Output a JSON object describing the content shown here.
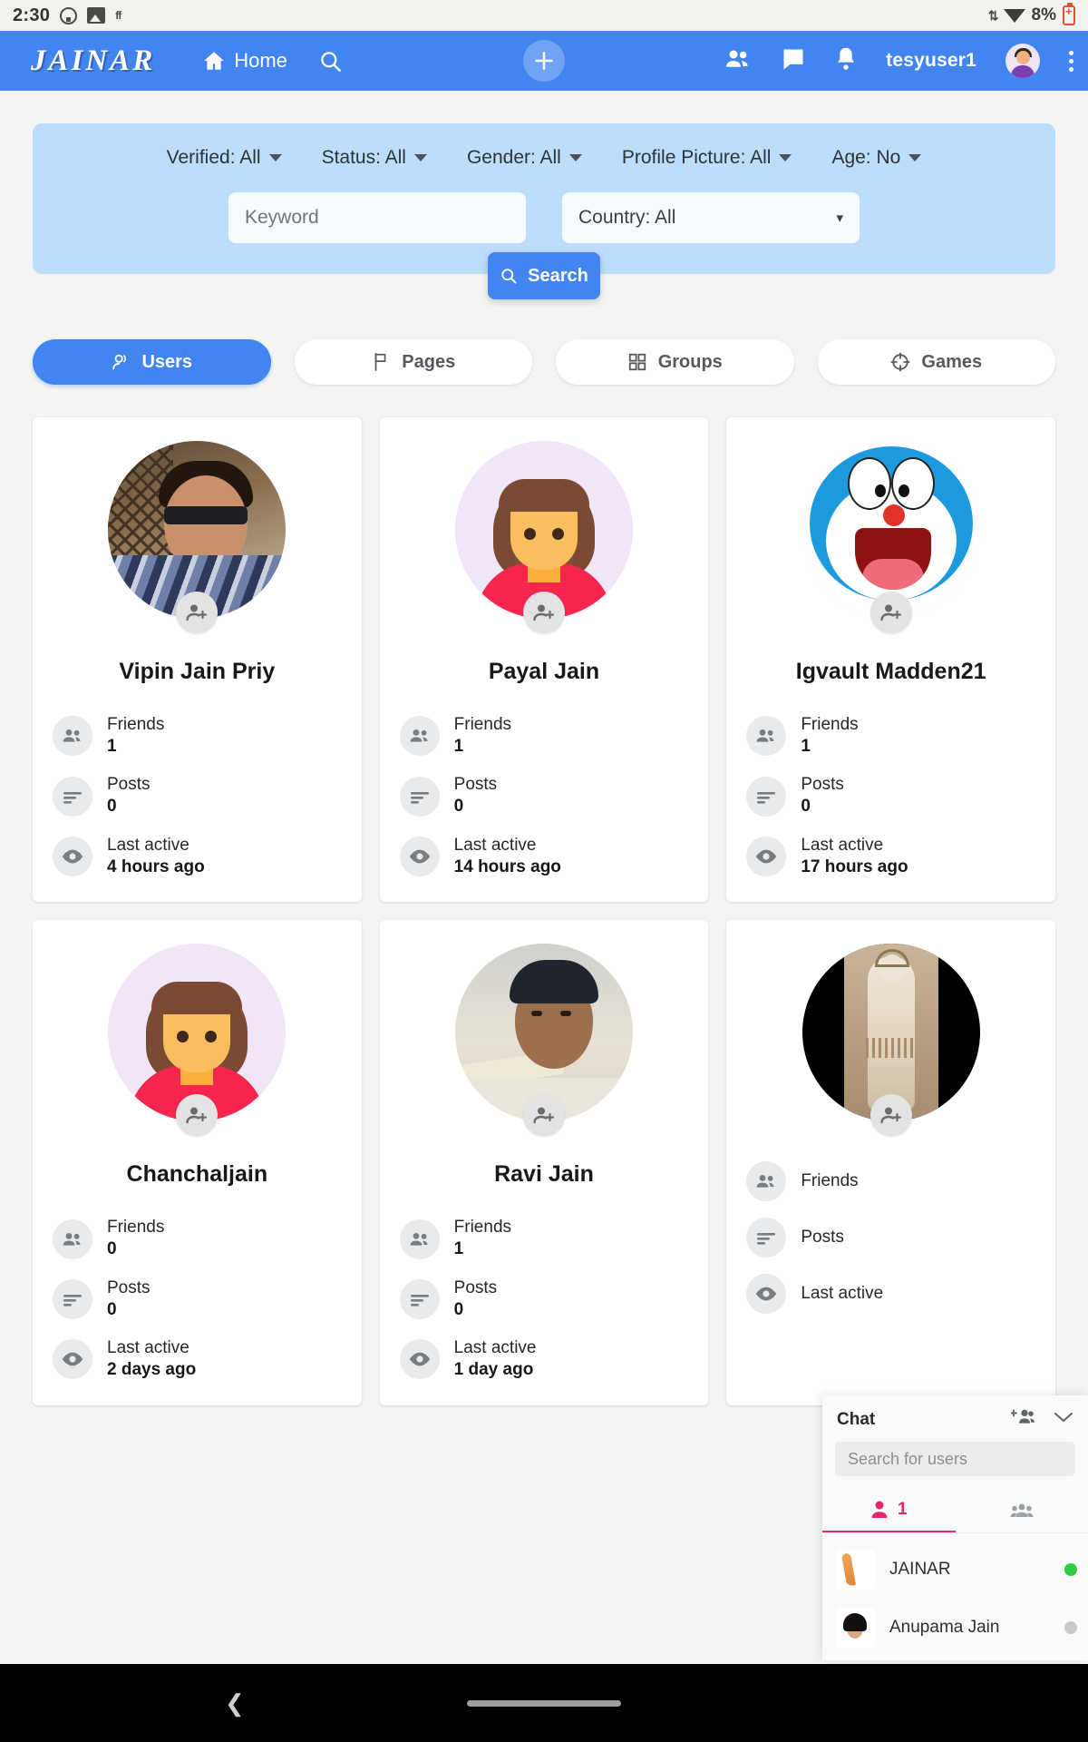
{
  "statusbar": {
    "time": "2:30",
    "icons_left": [
      "whatsapp-icon",
      "image-icon",
      "ff-icon"
    ],
    "battery_percent": "8%",
    "icons_right": [
      "data-transfer-icon",
      "wifi-icon",
      "battery-charging-icon"
    ]
  },
  "appbar": {
    "brand": "JAINAR",
    "home_label": "Home",
    "search_icon": "search-icon",
    "plus_icon": "plus-icon",
    "friends_icon": "people-icon",
    "messages_icon": "chat-bubble-icon",
    "notifications_icon": "bell-icon",
    "username": "tesyuser1",
    "avatar": "user-avatar",
    "menu_icon": "kebab-menu-icon",
    "bg_color": "#4285f0"
  },
  "filters": {
    "chips": [
      {
        "label": "Verified: All"
      },
      {
        "label": "Status: All"
      },
      {
        "label": "Gender: All"
      },
      {
        "label": "Profile Picture: All"
      },
      {
        "label": "Age: No"
      }
    ],
    "keyword_placeholder": "Keyword",
    "country_value": "Country: All",
    "search_label": "Search",
    "panel_color": "#bcddfb"
  },
  "tabs": [
    {
      "label": "Users",
      "icon": "user-search-icon",
      "active": true
    },
    {
      "label": "Pages",
      "icon": "flag-icon",
      "active": false
    },
    {
      "label": "Groups",
      "icon": "grid-icon",
      "active": false
    },
    {
      "label": "Games",
      "icon": "target-icon",
      "active": false
    }
  ],
  "stat_labels": {
    "friends": "Friends",
    "posts": "Posts",
    "last_active": "Last active"
  },
  "cards": [
    {
      "name": "Vipin Jain Priy",
      "friends": "1",
      "posts": "0",
      "last_active": "4 hours ago",
      "avatar_kind": "photo-man-sunglasses",
      "add_friend_icon": "add-friend-icon"
    },
    {
      "name": "Payal Jain",
      "friends": "1",
      "posts": "0",
      "last_active": "14 hours ago",
      "avatar_kind": "illustration-woman",
      "add_friend_icon": "add-friend-icon"
    },
    {
      "name": "Igvault Madden21",
      "friends": "1",
      "posts": "0",
      "last_active": "17 hours ago",
      "avatar_kind": "doraemon-cartoon",
      "add_friend_icon": "add-friend-icon"
    },
    {
      "name": "Chanchaljain",
      "friends": "0",
      "posts": "0",
      "last_active": "2 days ago",
      "avatar_kind": "illustration-woman",
      "add_friend_icon": "add-friend-icon"
    },
    {
      "name": "Ravi Jain",
      "friends": "1",
      "posts": "0",
      "last_active": "1 day ago",
      "avatar_kind": "photo-man",
      "add_friend_icon": "add-friend-icon"
    },
    {
      "name": "",
      "friends": "",
      "posts": "",
      "last_active": "",
      "avatar_kind": "photo-statue",
      "add_friend_icon": "add-friend-icon"
    }
  ],
  "chat": {
    "title": "Chat",
    "add_people_icon": "add-people-icon",
    "collapse_icon": "chevron-down-icon",
    "search_placeholder": "Search for users",
    "tabs": [
      {
        "icon": "person-icon",
        "count": "1",
        "active": true
      },
      {
        "icon": "group-icon",
        "count": "",
        "active": false
      }
    ],
    "accent_color": "#e6276b",
    "contacts": [
      {
        "name": "JAINAR",
        "status": "online",
        "avatar": "namaste-hands-icon"
      },
      {
        "name": "Anupama Jain",
        "status": "offline",
        "avatar": "user-photo"
      }
    ]
  },
  "bottomnav": {
    "back_icon": "back-chevron-icon",
    "home_pill": "home-indicator"
  }
}
